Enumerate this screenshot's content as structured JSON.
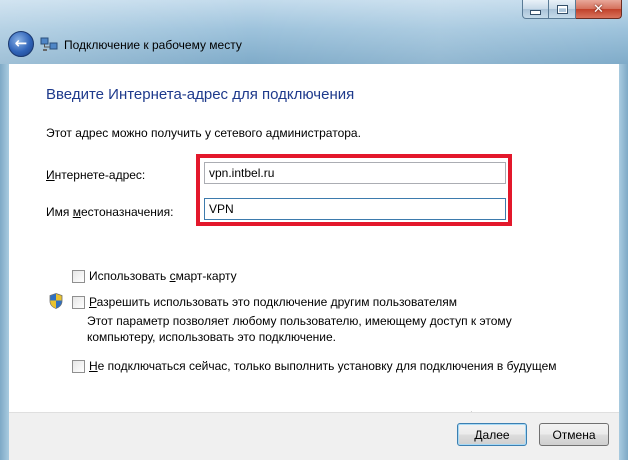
{
  "window": {
    "title": "Подключение к рабочему месту",
    "caption_icons": [
      "minimize-icon",
      "maximize-icon",
      "close-icon"
    ]
  },
  "heading": "Введите Интернета-адрес для подключения",
  "hint": "Этот адрес можно получить у сетевого администратора.",
  "fields": {
    "address": {
      "label_first": "И",
      "label_rest": "нтернете-адрес:",
      "value": "vpn.intbel.ru"
    },
    "destination": {
      "label_first": "И",
      "label_mid": "мя ",
      "label_u": "м",
      "label_rest": "естоназначения:",
      "value": "VPN"
    }
  },
  "options": {
    "smartcard": {
      "pre": "Использовать ",
      "u": "с",
      "post": "март-карту",
      "checked": false
    },
    "share": {
      "pre": "",
      "u": "Р",
      "post": "азрешить использовать это подключение другим пользователям",
      "checked": false,
      "description_line1": "Этот параметр позволяет любому пользователю, имеющему доступ к этому",
      "description_line2": "компьютеру, использовать это подключение."
    },
    "later": {
      "pre": "",
      "u": "Н",
      "post": "е подключаться сейчас, только выполнить установку для подключения в будущем",
      "checked": false
    }
  },
  "buttons": {
    "next": {
      "u": "Д",
      "rest": "алее"
    },
    "cancel": "Отмена"
  },
  "colors": {
    "heading": "#1e3a8c",
    "highlight": "#e3182b",
    "frame": "#8fb6cf"
  }
}
